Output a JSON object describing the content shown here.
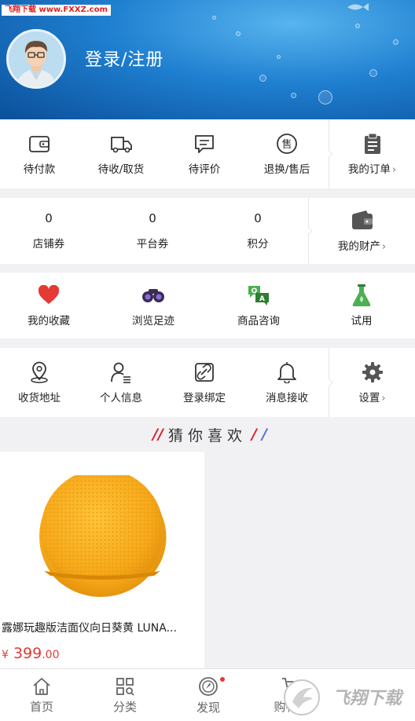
{
  "watermark": "飞翔下载 www.FXXZ.com",
  "header": {
    "login_label": "登录/注册"
  },
  "orders": {
    "items": [
      {
        "label": "待付款",
        "icon": "wallet-icon"
      },
      {
        "label": "待收/取货",
        "icon": "truck-icon"
      },
      {
        "label": "待评价",
        "icon": "comment-icon"
      },
      {
        "label": "退换/售后",
        "icon": "after-sale-icon"
      }
    ],
    "my_orders": {
      "label": "我的订单",
      "icon": "clipboard-icon"
    }
  },
  "assets": {
    "items": [
      {
        "value": "0",
        "label": "店铺券"
      },
      {
        "value": "0",
        "label": "平台券"
      },
      {
        "value": "0",
        "label": "积分"
      }
    ],
    "my_assets": {
      "label": "我的财产",
      "icon": "purse-icon"
    }
  },
  "features": {
    "items": [
      {
        "label": "我的收藏",
        "icon": "heart-icon"
      },
      {
        "label": "浏览足迹",
        "icon": "binoculars-icon"
      },
      {
        "label": "商品咨询",
        "icon": "qa-icon"
      },
      {
        "label": "试用",
        "icon": "flask-icon"
      }
    ]
  },
  "settings": {
    "items": [
      {
        "label": "收货地址",
        "icon": "location-icon"
      },
      {
        "label": "个人信息",
        "icon": "user-icon"
      },
      {
        "label": "登录绑定",
        "icon": "link-icon"
      },
      {
        "label": "消息接收",
        "icon": "bell-icon"
      }
    ],
    "settings_entry": {
      "label": "设置",
      "icon": "gear-icon"
    }
  },
  "guess": {
    "title": "猜你喜欢"
  },
  "products": [
    {
      "name": "露娜玩趣版洁面仪向日葵黄  LUNA...",
      "price_symbol": "¥",
      "price_int": "399",
      "price_dec": ".00",
      "color": "#f6a91a"
    }
  ],
  "bottom_nav": {
    "items": [
      {
        "label": "首页",
        "icon": "home-icon"
      },
      {
        "label": "分类",
        "icon": "category-icon"
      },
      {
        "label": "发现",
        "icon": "compass-icon"
      },
      {
        "label": "购物车",
        "icon": "cart-icon"
      }
    ]
  },
  "colors": {
    "accent": "#e53935",
    "header_blue": "#1f7fd0"
  }
}
